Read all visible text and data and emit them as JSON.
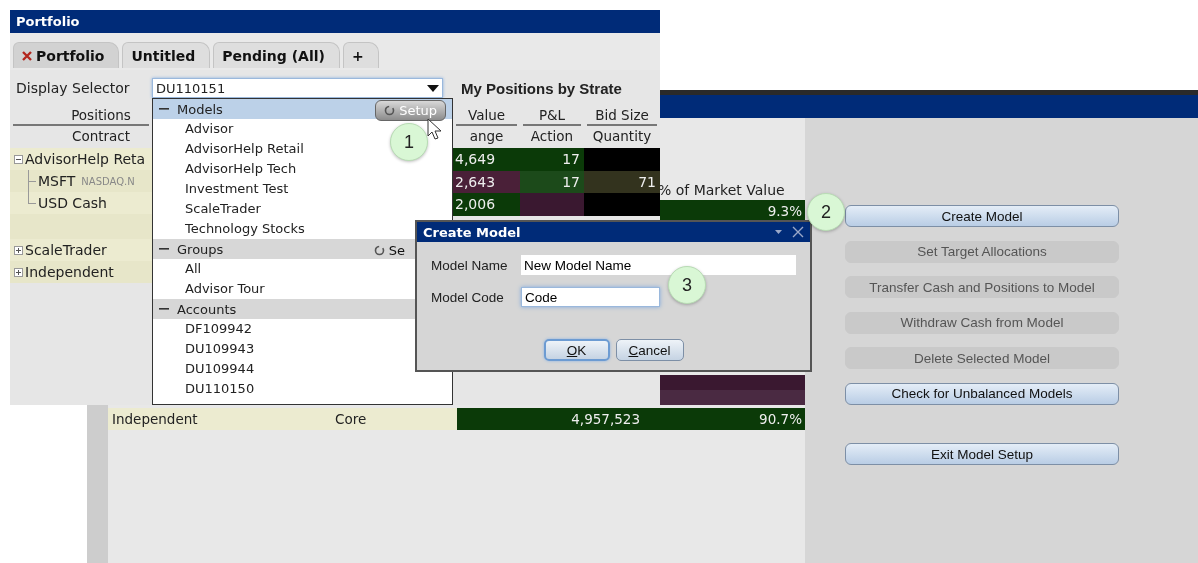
{
  "model_setup_window": {
    "market_value_header": "% of Market Value",
    "value_rows": [
      {
        "percent": "9.3%",
        "color": "#0b3a08"
      },
      {
        "color": "#3a1830"
      },
      {
        "color": "#4a2a42"
      }
    ],
    "summary_row": {
      "name": "Independent",
      "type": "Core",
      "market_value": "4,957,523",
      "percent": "90.7%",
      "color": "#0b3a08"
    },
    "buttons": [
      {
        "label": "Create Model",
        "disabled": false,
        "callout": "2"
      },
      {
        "label": "Set Target Allocations",
        "disabled": true
      },
      {
        "label": "Transfer Cash and Positions to Model",
        "disabled": true
      },
      {
        "label": "Withdraw Cash from Model",
        "disabled": true
      },
      {
        "label": "Delete Selected Model",
        "disabled": true
      },
      {
        "label": "Check for Unbalanced Models",
        "disabled": false
      }
    ],
    "exit_button": {
      "label": "Exit Model Setup"
    }
  },
  "portfolio_window": {
    "title": "Portfolio",
    "tabs": [
      {
        "label": "Portfolio",
        "selected": true,
        "closable": true
      },
      {
        "label": "Untitled",
        "selected": false,
        "closable": false
      },
      {
        "label": "Pending (All)",
        "selected": false,
        "closable": false
      },
      {
        "label": "+",
        "selected": false,
        "closable": false
      }
    ],
    "display_selector": {
      "label": "Display Selector",
      "value": "DU110151"
    },
    "view_title": "My Positions by Strate",
    "columns": [
      {
        "top": "Positions",
        "bottom": "Contract"
      },
      {
        "top": "Value",
        "bottom": "ange"
      },
      {
        "top": "P&L",
        "bottom": "Action"
      },
      {
        "top": "Bid Size",
        "bottom": "Quantity"
      }
    ],
    "tree": [
      {
        "label": "AdvisorHelp Reta",
        "expanded": true,
        "children": [
          {
            "label": "MSFT",
            "exchange": "NASDAQ.N"
          },
          {
            "label": "USD Cash"
          }
        ]
      },
      {
        "label": "ScaleTrader",
        "expanded": false
      },
      {
        "label": "Independent",
        "expanded": false
      }
    ],
    "data_rows": [
      {
        "cells": [
          {
            "text": "4,649",
            "color": "#0b3a08"
          },
          {
            "text": "17",
            "color": "#0b3a08"
          },
          {
            "color": "#000000"
          }
        ]
      },
      {
        "cells": [
          {
            "text": "2,643",
            "color": "#4a2038"
          },
          {
            "text": "17",
            "color": "#1c4a1a"
          },
          {
            "text": "71",
            "color": "#33331e"
          }
        ]
      },
      {
        "cells": [
          {
            "text": "2,006",
            "color": "#0b3a08"
          },
          {
            "color": "#3a1830"
          },
          {
            "color": "#000000"
          }
        ]
      }
    ]
  },
  "selector_dropdown": {
    "sections": [
      {
        "title": "Models",
        "expanded": true,
        "selected": true,
        "setup": {
          "label": "Setup",
          "hovered": true
        },
        "callout": "1",
        "items": [
          "Advisor",
          "AdvisorHelp Retail",
          "AdvisorHelp Tech",
          "Investment Test",
          "ScaleTrader",
          "Technology Stocks"
        ]
      },
      {
        "title": "Groups",
        "expanded": true,
        "selected": false,
        "setup": {
          "label": "Se",
          "hovered": false
        },
        "items": [
          "All",
          "Advisor Tour"
        ]
      },
      {
        "title": "Accounts",
        "expanded": true,
        "selected": false,
        "items": [
          "DF109942",
          "DU109943",
          "DU109944",
          "DU110150"
        ]
      }
    ]
  },
  "create_model_dialog": {
    "title": "Create Model",
    "callout": "3",
    "fields": [
      {
        "label": "Model Name",
        "value": "New Model Name",
        "focused": false
      },
      {
        "label": "Model Code",
        "value": "Code",
        "focused": true
      }
    ],
    "buttons": [
      {
        "label": "OK",
        "default": true
      },
      {
        "label": "Cancel",
        "default": false
      }
    ]
  }
}
